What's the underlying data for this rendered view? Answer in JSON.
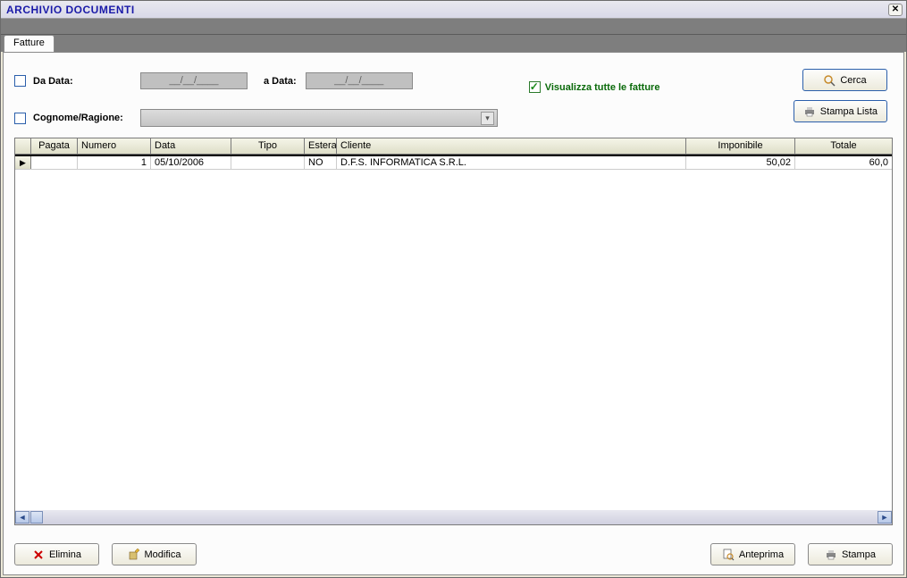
{
  "window": {
    "title": "ARCHIVIO DOCUMENTI"
  },
  "tabs": [
    {
      "label": "Fatture"
    }
  ],
  "filters": {
    "da_data_label": "Da Data:",
    "da_data_value": "__/__/____",
    "a_data_label": "a Data:",
    "a_data_value": "__/__/____",
    "cognome_label": "Cognome/Ragione:",
    "visualizza_tutte_label": "Visualizza tutte le fatture"
  },
  "buttons": {
    "cerca": "Cerca",
    "stampa_lista": "Stampa Lista",
    "elimina": "Elimina",
    "modifica": "Modifica",
    "anteprima": "Anteprima",
    "stampa": "Stampa"
  },
  "grid": {
    "headers": {
      "pagata": "Pagata",
      "numero": "Numero",
      "data": "Data",
      "tipo": "Tipo",
      "estera": "Estera",
      "cliente": "Cliente",
      "imponibile": "Imponibile",
      "totale": "Totale"
    },
    "rows": [
      {
        "pagata": "",
        "numero": "1",
        "data": "05/10/2006",
        "tipo": "",
        "estera": "NO",
        "cliente": "D.F.S. INFORMATICA S.R.L.",
        "imponibile": "50,02",
        "totale": "60,0"
      }
    ]
  }
}
